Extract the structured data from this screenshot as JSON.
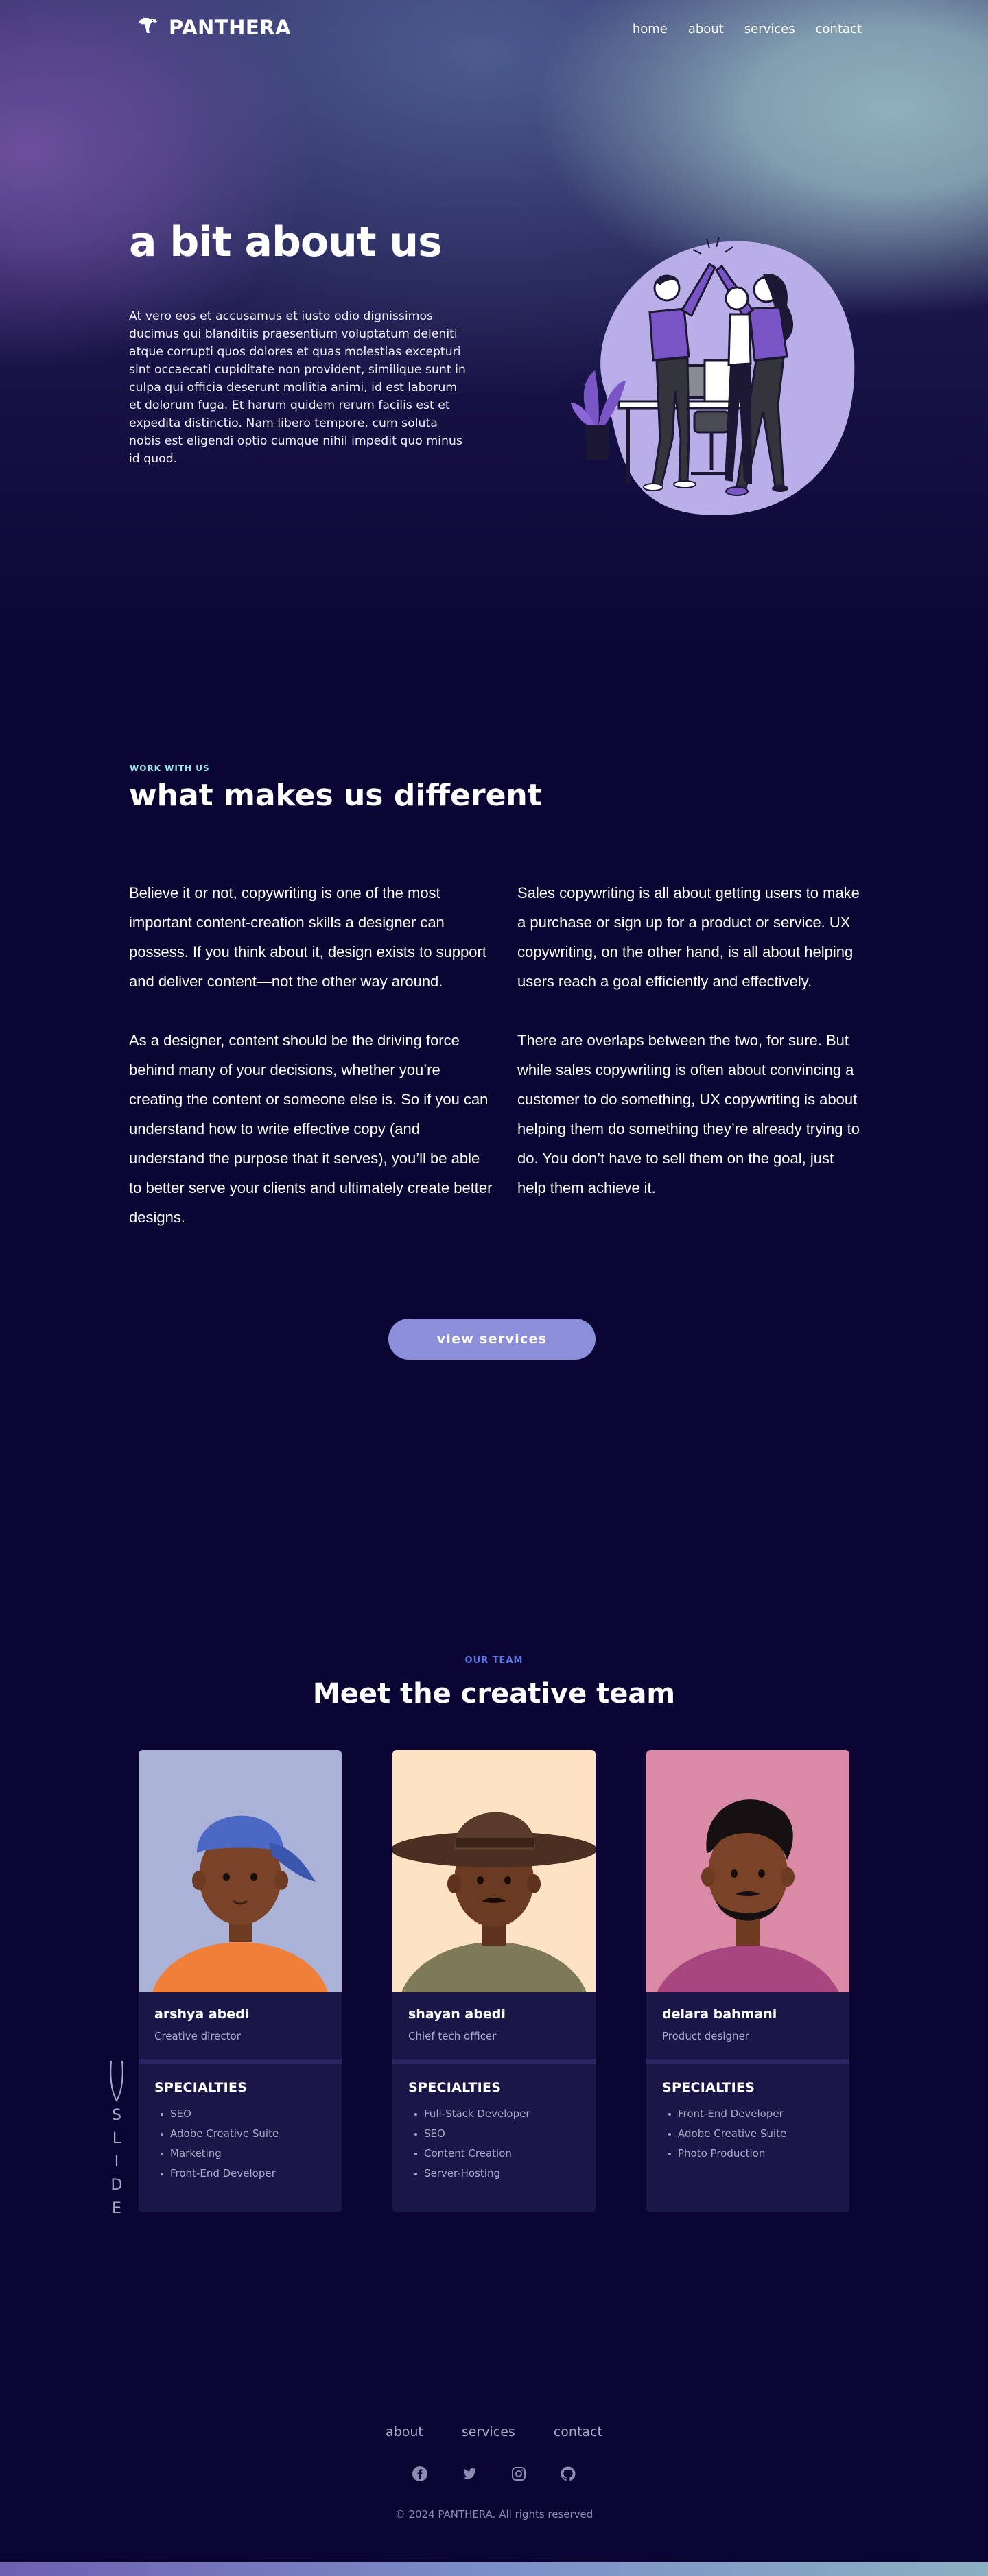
{
  "brand": {
    "name": "PANTHERA"
  },
  "nav": {
    "items": [
      "home",
      "about",
      "services",
      "contact"
    ]
  },
  "hero": {
    "title": "a bit about us",
    "body": "At vero eos et accusamus et iusto odio dignissimos ducimus qui blanditiis praesentium voluptatum deleniti atque corrupti quos dolores et quas molestias excepturi sint occaecati cupiditate non provident, similique sunt in culpa qui officia deserunt mollitia animi, id est laborum et dolorum fuga. Et harum quidem rerum facilis est et expedita distinctio. Nam libero tempore, cum soluta nobis est eligendi optio cumque nihil impedit quo minus id quod."
  },
  "different": {
    "eyebrow": "WORK WITH US",
    "title": "what makes us different",
    "left": [
      "Believe it or not, copywriting is one of the most important content-creation skills a designer can possess. If you think about it, design exists to support and deliver content—not the other way around.",
      "As a designer, content should be the driving force behind many of your decisions, whether you’re creating the content or someone else is. So if you can understand how to write effective copy (and understand the purpose that it serves), you’ll be able to better serve your clients and ultimately create better designs."
    ],
    "right": [
      "Sales copywriting is all about getting users to make a purchase or sign up for a product or service. UX copywriting, on the other hand, is all about helping users reach a goal efficiently and effectively.",
      "There are overlaps between the two, for sure. But while sales copywriting is often about convincing a customer to do something, UX copywriting is about helping them do something they’re already trying to do. You don’t have to sell them on the goal, just help them achieve it."
    ],
    "button": "view services"
  },
  "team": {
    "eyebrow": "OUR TEAM",
    "title": "Meet the creative team",
    "specialties_label": "SPECIALTIES",
    "members": [
      {
        "name": "arshya abedi",
        "role": "Creative director",
        "bg": "#aab2d8",
        "specialties": [
          "SEO",
          "Adobe Creative Suite",
          "Marketing",
          "Front-End Developer"
        ]
      },
      {
        "name": "shayan abedi",
        "role": "Chief tech officer",
        "bg": "#fde3c3",
        "specialties": [
          "Full-Stack Developer",
          "SEO",
          "Content Creation",
          "Server-Hosting"
        ]
      },
      {
        "name": "delara bahmani",
        "role": "Product designer",
        "bg": "#d98aa6",
        "specialties": [
          "Front-End Developer",
          "Adobe Creative Suite",
          "Photo Production"
        ]
      }
    ],
    "slide_hint": "SLIDE"
  },
  "footer": {
    "links": [
      "about",
      "services",
      "contact"
    ],
    "socials": [
      "facebook-icon",
      "twitter-icon",
      "instagram-icon",
      "github-icon"
    ],
    "copyright": "© 2024 PANTHERA. All rights reserved"
  },
  "colors": {
    "background": "#0a0533",
    "accent": "#8d8ed9",
    "card": "#1b1648",
    "eyebrow": "#9fe6ee",
    "team_eyebrow": "#5b79e8"
  }
}
